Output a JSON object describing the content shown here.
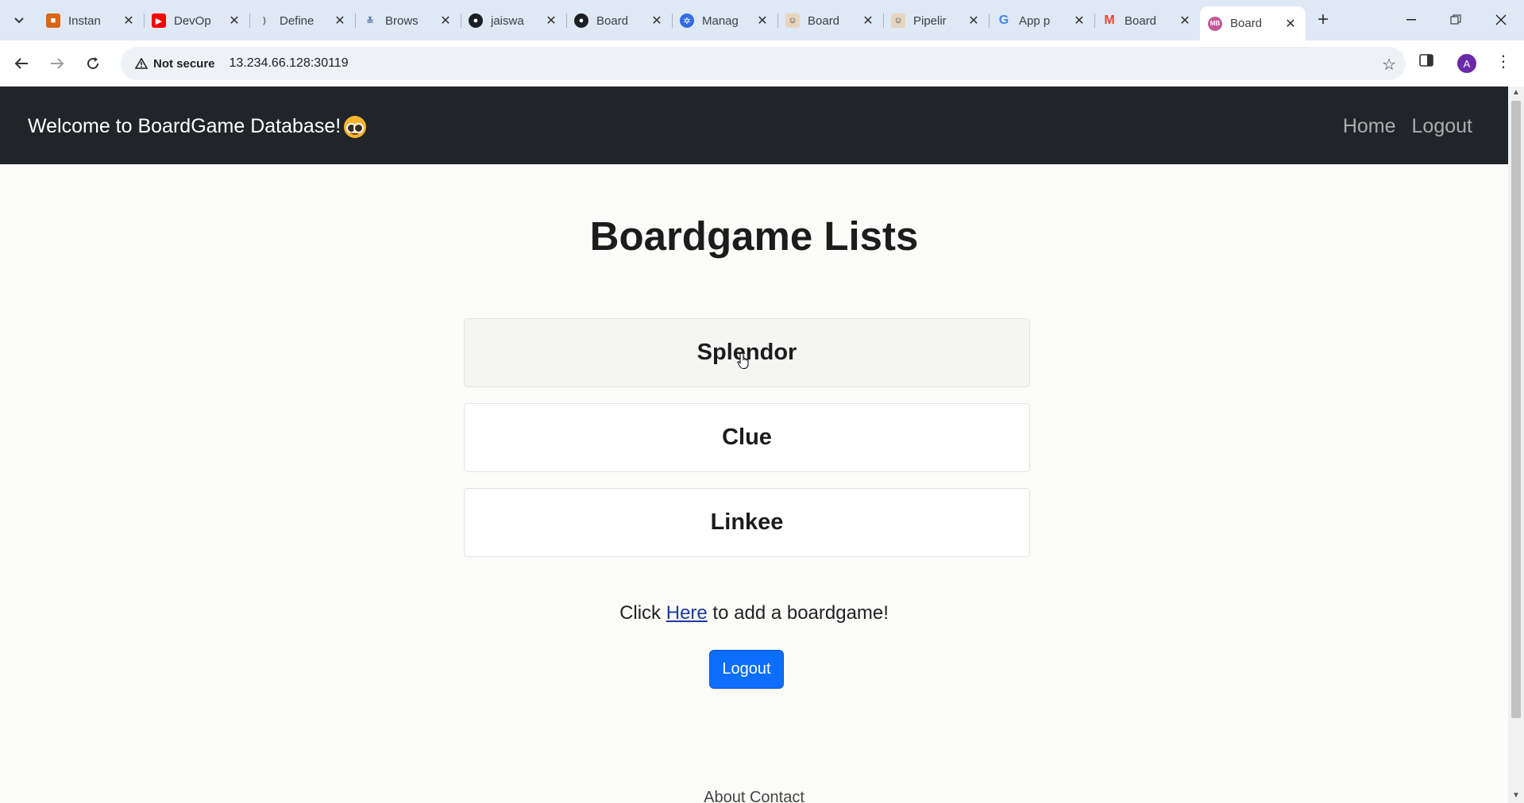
{
  "browser": {
    "tabs": [
      {
        "title": "Instan",
        "icon": "aws-icon",
        "color": "#d86613"
      },
      {
        "title": "DevOp",
        "icon": "youtube-icon",
        "color": "#ff0000"
      },
      {
        "title": "Define",
        "icon": "leaf-icon",
        "color": "#6b6b6b"
      },
      {
        "title": "Brows",
        "icon": "browserstack-icon",
        "color": "#2b5797"
      },
      {
        "title": "jaiswa",
        "icon": "github-icon",
        "color": "#1b1f23"
      },
      {
        "title": "Board",
        "icon": "github-icon",
        "color": "#1b1f23"
      },
      {
        "title": "Manag",
        "icon": "kubernetes-icon",
        "color": "#326ce5"
      },
      {
        "title": "Board",
        "icon": "jenkins-icon",
        "color": "#d33833"
      },
      {
        "title": "Pipelir",
        "icon": "jenkins-icon",
        "color": "#d33833"
      },
      {
        "title": "App p",
        "icon": "google-icon",
        "color": "#4285f4"
      },
      {
        "title": "Board",
        "icon": "gmail-icon",
        "color": "#ea4335"
      },
      {
        "title": "Board",
        "icon": "mb-icon",
        "color": "#c2599a",
        "active": true
      }
    ],
    "security_label": "Not secure",
    "url": "13.234.66.128:30119",
    "avatar_letter": "A"
  },
  "navbar": {
    "brand": "Welcome to BoardGame Database!",
    "links": [
      "Home",
      "Logout"
    ]
  },
  "main": {
    "title": "Boardgame Lists",
    "games": [
      "Splendor",
      "Clue",
      "Linkee"
    ],
    "add_prefix": "Click ",
    "add_link": "Here",
    "add_suffix": " to add a boardgame!",
    "logout_button": "Logout",
    "footer": "About Contact"
  },
  "colors": {
    "navbar_bg": "#212529",
    "primary_button": "#0d6efd",
    "page_bg": "#fbfbf9"
  }
}
